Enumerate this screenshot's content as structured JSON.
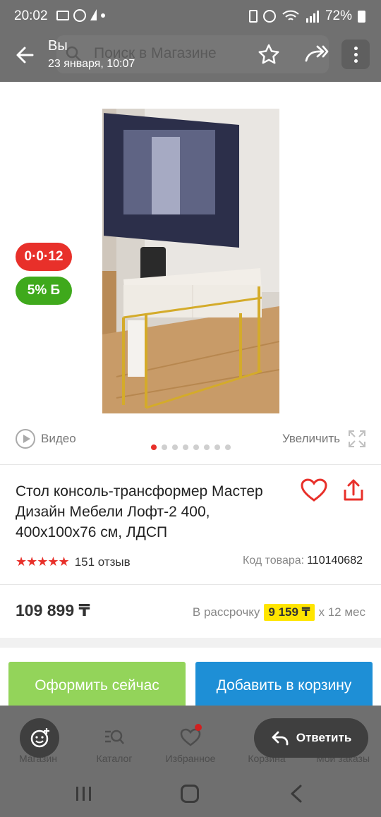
{
  "status_bar": {
    "time": "20:02",
    "battery": "72%"
  },
  "viewer": {
    "sender": "Вы",
    "date": "23 января, 10:07"
  },
  "search": {
    "placeholder": "Поиск в Магазине"
  },
  "badges": {
    "installment": "0·0·12",
    "bonus": "5% Б"
  },
  "media": {
    "video_label": "Видео",
    "zoom_label": "Увеличить",
    "slide_count": 8,
    "active_slide": 1
  },
  "product": {
    "title": "Стол консоль-трансформер Мастер Дизайн Мебели Лофт-2 400, 400х100х76 см, ЛДСП",
    "rating": 5,
    "reviews": "151 отзыв",
    "code_label": "Код товара:",
    "code": "110140682",
    "price": "109 899 ₸",
    "installment_label": "В рассрочку",
    "installment_amount": "9 159 ₸",
    "installment_term": "х 12 мес"
  },
  "actions": {
    "order_now": "Оформить сейчас",
    "add_to_cart": "Добавить в корзину"
  },
  "tabs": [
    {
      "label": "Магазин"
    },
    {
      "label": "Каталог"
    },
    {
      "label": "Избранное"
    },
    {
      "label": "Корзина"
    },
    {
      "label": "Мои заказы"
    }
  ],
  "reply": {
    "label": "Ответить"
  },
  "colors": {
    "accent_red": "#e8302a",
    "bonus_green": "#3fa91c",
    "order_green": "#93d45a",
    "cart_blue": "#1e8fd6",
    "installment_yellow": "#ffe500"
  }
}
